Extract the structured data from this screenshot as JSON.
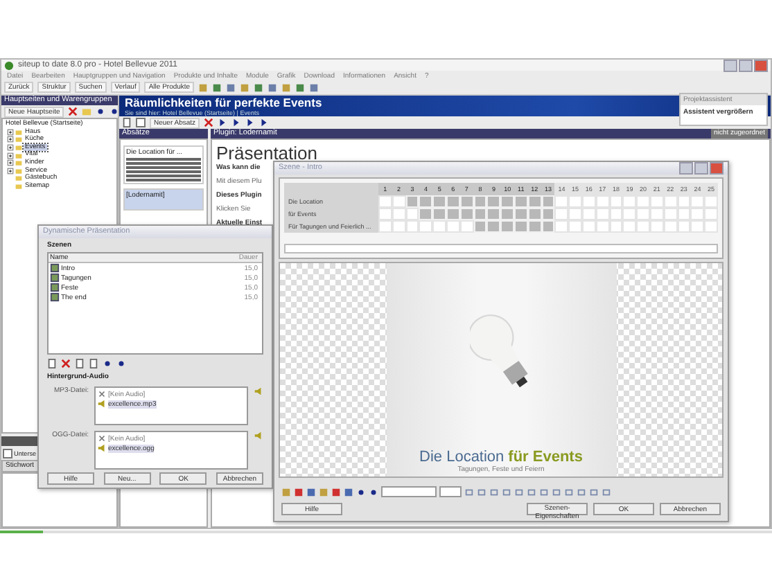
{
  "window": {
    "title": "siteup to date 8.0 pro - Hotel Bellevue 2011"
  },
  "menu": [
    "Datei",
    "Bearbeiten",
    "Hauptgruppen und Navigation",
    "Produkte und Inhalte",
    "Module",
    "Grafik",
    "Download",
    "Informationen",
    "Ansicht",
    "?"
  ],
  "toolbar": [
    "Zurück",
    "Struktur",
    "Suchen",
    "Verlauf",
    "Alle Produkte"
  ],
  "sidebar": {
    "title": "Hauptseiten und Warengruppen",
    "new_button": "Neue Hauptseite",
    "tree": [
      {
        "label": "Hotel Bellevue (Startseite)",
        "expandable": false,
        "selected": false,
        "children": [
          {
            "label": "Haus",
            "expandable": true,
            "selected": false
          },
          {
            "label": "Küche",
            "expandable": true,
            "selected": false
          },
          {
            "label": "Events",
            "expandable": true,
            "selected": true
          },
          {
            "label": "Vital",
            "expandable": true,
            "selected": false
          },
          {
            "label": "Kinder",
            "expandable": true,
            "selected": false
          },
          {
            "label": "Service",
            "expandable": true,
            "selected": false
          },
          {
            "label": "Gästebuch",
            "expandable": false,
            "selected": false
          },
          {
            "label": "Sitemap",
            "expandable": false,
            "selected": false
          }
        ]
      }
    ]
  },
  "bottom_panel": {
    "checkbox_label": "Unterse",
    "checked": false,
    "column": "Stichwort"
  },
  "progress": {
    "level": 0.055
  },
  "page": {
    "title": "Räumlichkeiten für perfekte Events",
    "breadcrumb": "Sie sind hier: Hotel Bellevue (Startseite) | Events",
    "new_paragraph": "Neuer Absatz",
    "checked": false
  },
  "assistant": {
    "title": "Projektassistent",
    "button": "Assistent vergrößern"
  },
  "paragraphs": {
    "title": "Absätze",
    "items": [
      {
        "label": "Die Location für ...",
        "selected": false
      },
      {
        "label": "[Lodernamit]",
        "selected": true
      }
    ]
  },
  "plugin": {
    "title": "Plugin: Lodernamit",
    "status": "nicht zugeordnet",
    "heading": "Präsentation",
    "lines": [
      {
        "text": "Was kann die",
        "kind": "bold"
      },
      {
        "text": "Mit diesem Plu",
        "kind": "plain"
      },
      {
        "text": "Dieses Plugin",
        "kind": "bold"
      },
      {
        "text": "Klicken Sie",
        "kind": "plain"
      },
      {
        "text": "Aktuelle Einst",
        "kind": "bold"
      }
    ]
  },
  "presentation_dialog": {
    "title": "Dynamische Präsentation",
    "scenes_label": "Szenen",
    "columns": [
      "Name",
      "Dauer"
    ],
    "scenes": [
      {
        "name": "Intro",
        "duration": "15,0",
        "selected": false
      },
      {
        "name": "Tagungen",
        "duration": "15,0",
        "selected": false
      },
      {
        "name": "Feste",
        "duration": "15,0",
        "selected": false
      },
      {
        "name": "The end",
        "duration": "15,0",
        "selected": false
      }
    ],
    "audio_label": "Hintergrund-Audio",
    "audio": [
      {
        "label": "MP3-Datei:",
        "items": [
          {
            "text": "[Kein Audio]",
            "kind": "none"
          },
          {
            "text": "excellence.mp3",
            "kind": "file"
          }
        ]
      },
      {
        "label": "OGG-Datei:",
        "items": [
          {
            "text": "[Kein Audio]",
            "kind": "none"
          },
          {
            "text": "excellence.ogg",
            "kind": "file"
          }
        ]
      }
    ],
    "buttons": [
      "Hilfe",
      "Neu...",
      "OK",
      "Abbrechen"
    ]
  },
  "scene_dialog": {
    "title": "Szene - Intro",
    "frames": [
      {
        "label": "1",
        "active": true
      },
      {
        "label": "2",
        "active": true
      },
      {
        "label": "3",
        "active": true
      },
      {
        "label": "4",
        "active": true
      },
      {
        "label": "5",
        "active": true
      },
      {
        "label": "6",
        "active": true
      },
      {
        "label": "7",
        "active": true
      },
      {
        "label": "8",
        "active": true
      },
      {
        "label": "9",
        "active": true
      },
      {
        "label": "10",
        "active": true
      },
      {
        "label": "11",
        "active": true
      },
      {
        "label": "12",
        "active": true
      },
      {
        "label": "13",
        "active": true
      },
      {
        "label": "14",
        "active": false
      },
      {
        "label": "15",
        "active": false
      },
      {
        "label": "16",
        "active": false
      },
      {
        "label": "17",
        "active": false
      },
      {
        "label": "18",
        "active": false
      },
      {
        "label": "19",
        "active": false
      },
      {
        "label": "20",
        "active": false
      },
      {
        "label": "21",
        "active": false
      },
      {
        "label": "22",
        "active": false
      },
      {
        "label": "23",
        "active": false
      },
      {
        "label": "24",
        "active": false
      },
      {
        "label": "25",
        "active": false
      }
    ],
    "tracks": [
      {
        "label": "Die Location",
        "filled": [
          false,
          false,
          true,
          true,
          true,
          true,
          true,
          true,
          true,
          true,
          true,
          true,
          true,
          false,
          false,
          false,
          false,
          false,
          false,
          false,
          false,
          false,
          false,
          false,
          false
        ]
      },
      {
        "label": "für Events",
        "filled": [
          false,
          false,
          false,
          true,
          true,
          true,
          true,
          true,
          true,
          true,
          true,
          true,
          true,
          false,
          false,
          false,
          false,
          false,
          false,
          false,
          false,
          false,
          false,
          false,
          false
        ]
      },
      {
        "label": "Für Tagungen und Feierlich ...",
        "filled": [
          false,
          false,
          false,
          false,
          false,
          false,
          false,
          true,
          true,
          true,
          true,
          true,
          true,
          false,
          false,
          false,
          false,
          false,
          false,
          false,
          false,
          false,
          false,
          false,
          false
        ]
      }
    ],
    "slide": {
      "title": [
        {
          "text": "Die Location",
          "kind": "plain"
        },
        {
          "text": "für Events",
          "kind": "accent"
        }
      ],
      "subtitle": "Tagungen, Feste und Feiern"
    },
    "buttons": [
      "Hilfe",
      "Szenen-Eigenschaften",
      "OK",
      "Abbrechen"
    ]
  }
}
